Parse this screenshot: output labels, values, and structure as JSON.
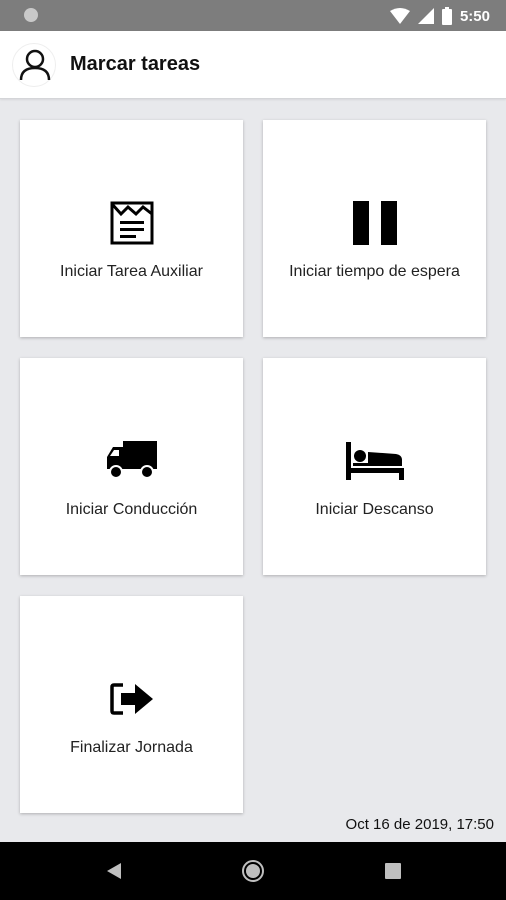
{
  "status_bar": {
    "time": "5:50",
    "icons": [
      "notification-dot-icon",
      "wifi-icon",
      "signal-icon",
      "battery-icon"
    ]
  },
  "app_bar": {
    "title": "Marcar tareas",
    "avatar_icon": "user-icon"
  },
  "tiles": [
    {
      "label": "Iniciar Tarea Auxiliar",
      "icon": "auxiliary-task-icon"
    },
    {
      "label": "Iniciar tiempo de espera",
      "icon": "pause-icon"
    },
    {
      "label": "Iniciar Conducción",
      "icon": "truck-icon"
    },
    {
      "label": "Iniciar Descanso",
      "icon": "bed-icon"
    },
    {
      "label": "Finalizar Jornada",
      "icon": "exit-icon"
    }
  ],
  "footer": {
    "datetime": "Oct 16 de 2019, 17:50"
  },
  "nav_bar": {
    "buttons": [
      "back-icon",
      "home-icon",
      "recents-icon"
    ]
  }
}
